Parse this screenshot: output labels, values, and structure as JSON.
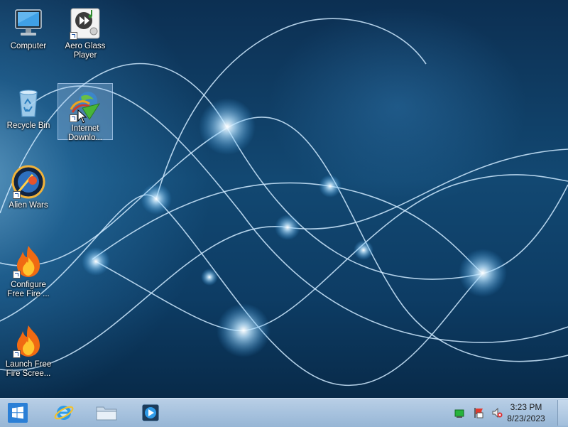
{
  "desktop": {
    "icons": [
      {
        "label": "Computer",
        "icon": "computer-icon"
      },
      {
        "label": "Aero Glass Player",
        "icon": "media-player-icon"
      },
      {
        "label": "Recycle Bin",
        "icon": "recycle-bin-icon"
      },
      {
        "label": "Internet Downlo...",
        "icon": "internet-download-manager-icon",
        "selected": true
      },
      {
        "label": "Alien Wars",
        "icon": "alien-wars-icon"
      },
      {
        "label": "Configure Free Fire ...",
        "icon": "flame-icon"
      },
      {
        "label": "Launch Free Fire Scree...",
        "icon": "flame-icon"
      }
    ]
  },
  "taskbar": {
    "start": {
      "icon": "windows-logo-icon"
    },
    "pinned": [
      {
        "name": "Internet Explorer",
        "icon": "internet-explorer-icon"
      },
      {
        "name": "File Explorer",
        "icon": "folder-icon"
      },
      {
        "name": "Media Player",
        "icon": "media-player-icon"
      }
    ],
    "tray": {
      "icons": [
        "network-icon",
        "action-center-flag-icon",
        "volume-muted-icon"
      ],
      "time": "3:23 PM",
      "date": "8/23/2023"
    }
  },
  "colors": {
    "taskbar": "#a7c2de",
    "desktop": "#124872",
    "accent": "#2f8fd8"
  }
}
